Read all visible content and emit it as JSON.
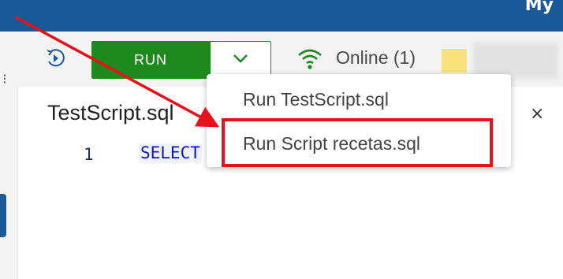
{
  "header": {
    "user_label": "My"
  },
  "toolbar": {
    "history_icon": "history-icon",
    "run_label": "RUN",
    "dropdown_icon": "chevron-down-icon",
    "connection_icon": "wifi-icon",
    "status_text": "Online (1)"
  },
  "editor": {
    "tab_title": "TestScript.sql",
    "close_label": "×",
    "line_number": "1",
    "code_text": "SELECT"
  },
  "run_menu": {
    "items": [
      {
        "label": "Run TestScript.sql"
      },
      {
        "label": "Run Script recetas.sql"
      }
    ]
  },
  "colors": {
    "header_bg": "#1a5a9a",
    "run_green": "#1e8a1e",
    "annotation_red": "#e8101a",
    "code_keyword": "#1010cc",
    "status_swatch": "#f9e27a"
  }
}
